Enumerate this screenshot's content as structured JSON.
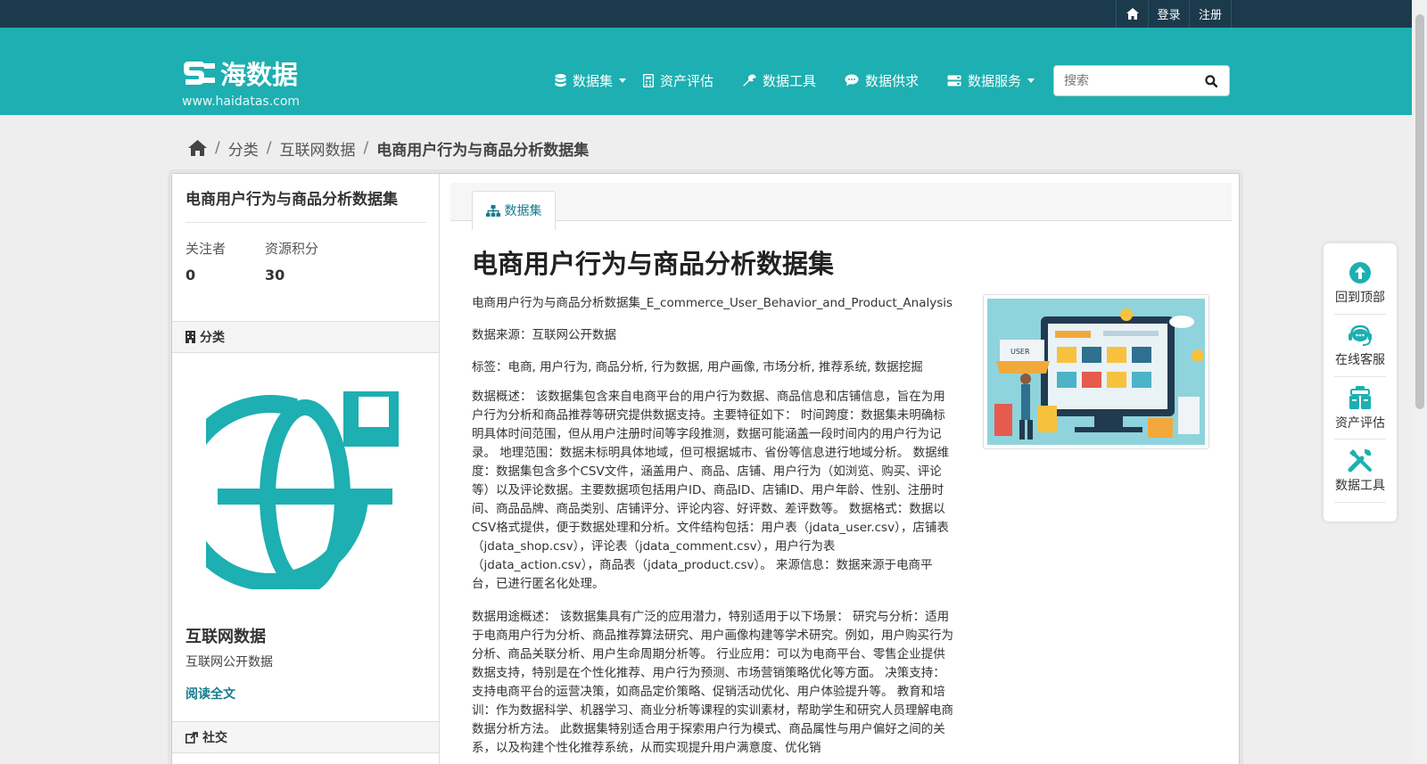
{
  "topbar": {
    "home_icon": "home-icon",
    "login": "登录",
    "register": "注册"
  },
  "brand": {
    "name": "海数据",
    "url": "www.haidatas.com"
  },
  "nav": {
    "items": [
      {
        "label": "数据集",
        "icon": "database-icon",
        "dropdown": true
      },
      {
        "label": "资产评估",
        "icon": "calculator-icon",
        "dropdown": false
      },
      {
        "label": "数据工具",
        "icon": "wrench-icon",
        "dropdown": false
      },
      {
        "label": "数据供求",
        "icon": "comment-icon",
        "dropdown": false
      },
      {
        "label": "数据服务",
        "icon": "hdd-icon",
        "dropdown": true
      }
    ],
    "search_placeholder": "搜索"
  },
  "breadcrumb": {
    "items": [
      "分类",
      "互联网数据"
    ],
    "current": "电商用户行为与商品分析数据集"
  },
  "sidebar": {
    "title": "电商用户行为与商品分析数据集",
    "stats": [
      {
        "label": "关注者",
        "value": "0"
      },
      {
        "label": "资源积分",
        "value": "30"
      }
    ],
    "category_heading": "分类",
    "category_name": "互联网数据",
    "category_desc": "互联网公开数据",
    "read_more": "阅读全文",
    "social_heading": "社交"
  },
  "content": {
    "tab_label": "数据集",
    "title": "电商用户行为与商品分析数据集",
    "filename": "电商用户行为与商品分析数据集_E_commerce_User_Behavior_and_Product_Analysis",
    "source": "数据来源：互联网公开数据",
    "tags": "标签：电商, 用户行为, 商品分析, 行为数据, 用户画像, 市场分析, 推荐系统, 数据挖掘",
    "overview": "数据概述： 该数据集包含来自电商平台的用户行为数据、商品信息和店铺信息，旨在为用户行为分析和商品推荐等研究提供数据支持。主要特征如下： 时间跨度：数据集未明确标明具体时间范围，但从用户注册时间等字段推测，数据可能涵盖一段时间内的用户行为记录。 地理范围：数据未标明具体地域，但可根据城市、省份等信息进行地域分析。 数据维度：数据集包含多个CSV文件，涵盖用户、商品、店铺、用户行为（如浏览、购买、评论等）以及评论数据。主要数据项包括用户ID、商品ID、店铺ID、用户年龄、性别、注册时间、商品品牌、商品类别、店铺评分、评论内容、好评数、差评数等。 数据格式：数据以CSV格式提供，便于数据处理和分析。文件结构包括：用户表（jdata_user.csv），店铺表（jdata_shop.csv），评论表（jdata_comment.csv），用户行为表（jdata_action.csv），商品表（jdata_product.csv）。 来源信息：数据来源于电商平台，已进行匿名化处理。",
    "usage": "数据用途概述： 该数据集具有广泛的应用潜力，特别适用于以下场景： 研究与分析：适用于电商用户行为分析、商品推荐算法研究、用户画像构建等学术研究。例如，用户购买行为分析、商品关联分析、用户生命周期分析等。 行业应用：可以为电商平台、零售企业提供数据支持，特别是在个性化推荐、用户行为预测、市场营销策略优化等方面。 决策支持：支持电商平台的运营决策，如商品定价策略、促销活动优化、用户体验提升等。 教育和培训：作为数据科学、机器学习、商业分析等课程的实训素材，帮助学生和研究人员理解电商数据分析方法。 此数据集特别适合用于探索用户行为模式、商品属性与用户偏好之间的关系，以及构建个性化推荐系统，从而实现提升用户满意度、优化销",
    "thumbnail_text": "USER"
  },
  "float_panel": {
    "items": [
      {
        "label": "回到顶部",
        "icon": "arrow-up-circle-icon"
      },
      {
        "label": "在线客服",
        "icon": "headset-icon"
      },
      {
        "label": "资产评估",
        "icon": "assessment-icon"
      },
      {
        "label": "数据工具",
        "icon": "tools-icon"
      }
    ]
  },
  "colors": {
    "teal": "#1dafb1",
    "topbar": "#1b3a4b",
    "link": "#187b8e"
  }
}
